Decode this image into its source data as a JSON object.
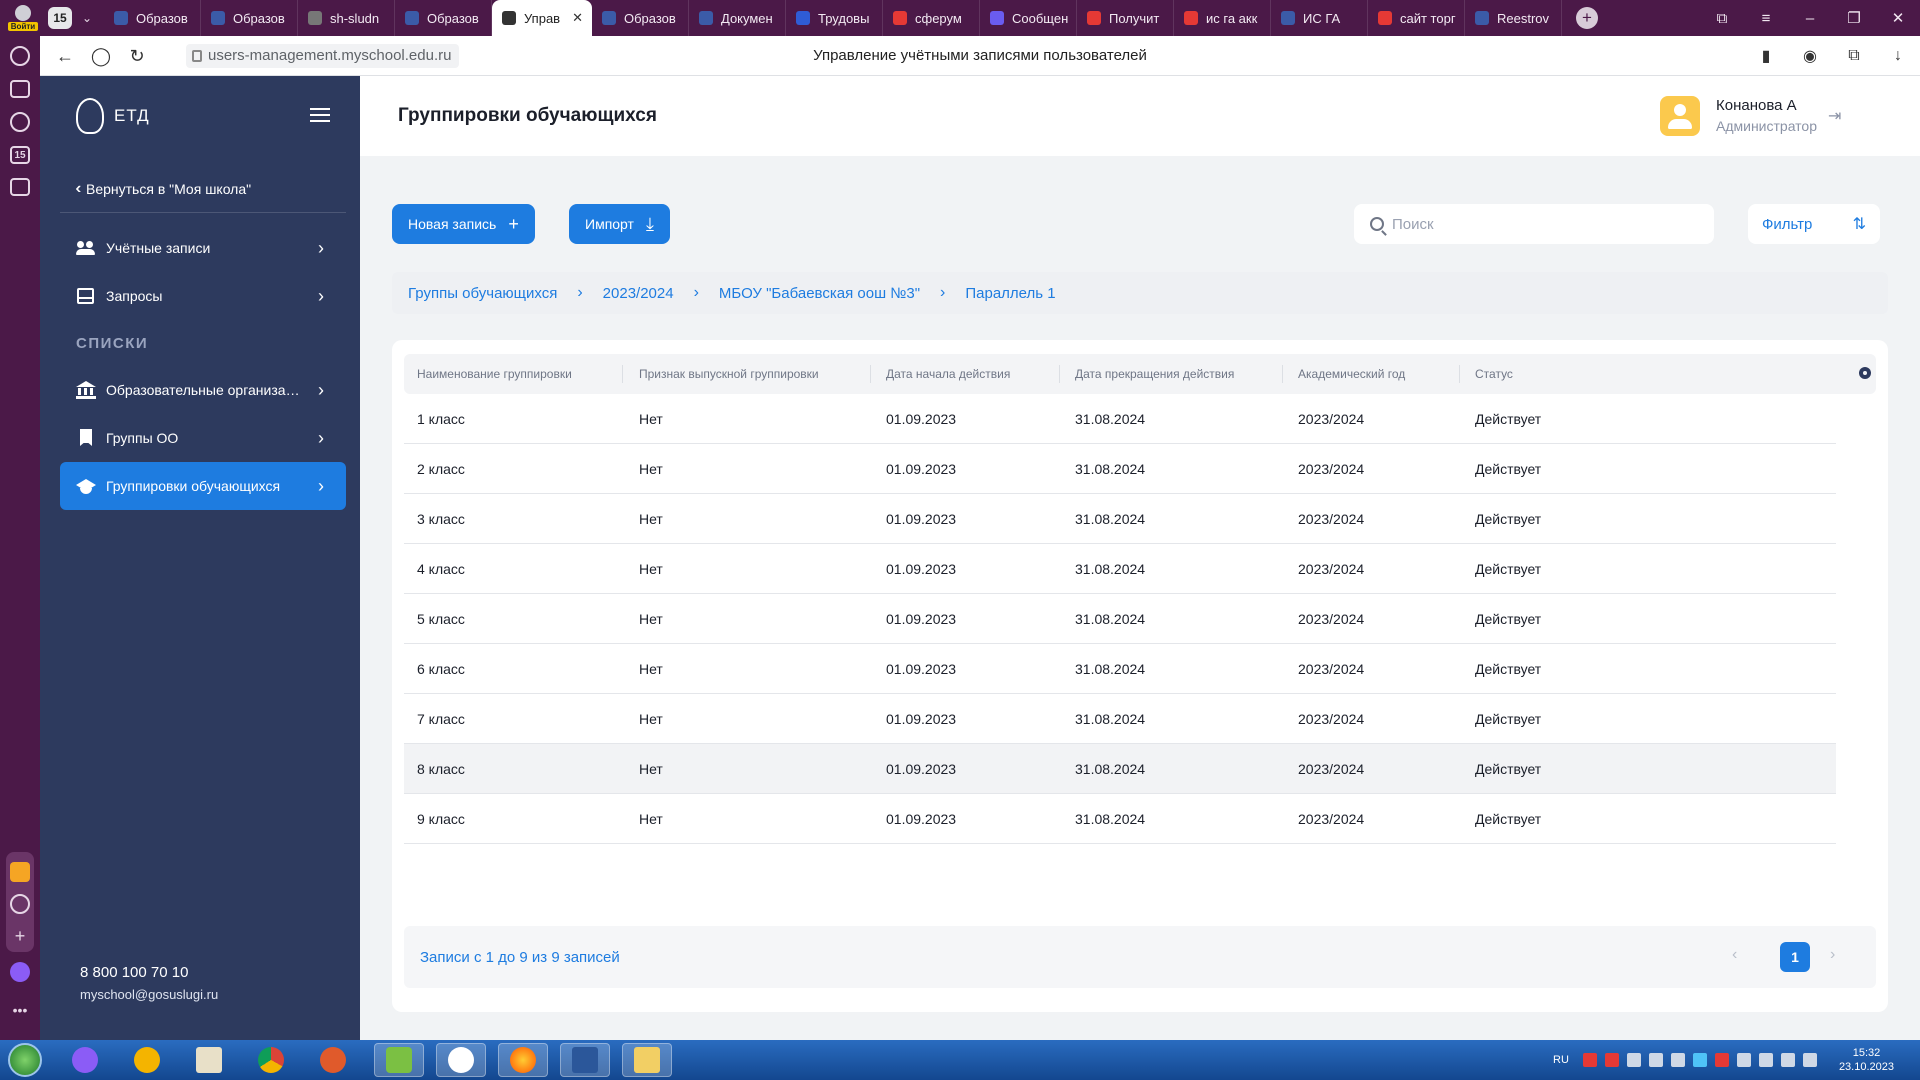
{
  "browser": {
    "profile_label": "Войти",
    "tab_count": "15",
    "tabs": [
      {
        "title": "Образов",
        "color": "#3b5ba8"
      },
      {
        "title": "Образов",
        "color": "#3b5ba8"
      },
      {
        "title": "sh-sludn",
        "color": "#777777"
      },
      {
        "title": "Образов",
        "color": "#3b5ba8"
      },
      {
        "title": "Управ",
        "color": "#333333",
        "active": true
      },
      {
        "title": "Образов",
        "color": "#3b5ba8"
      },
      {
        "title": "Докумен",
        "color": "#3b5ba8"
      },
      {
        "title": "Трудовы",
        "color": "#2f5cd6"
      },
      {
        "title": "сферум",
        "color": "#e53935"
      },
      {
        "title": "Сообщен",
        "color": "#6a5cf0"
      },
      {
        "title": "Получит",
        "color": "#e53935"
      },
      {
        "title": "ис га акк",
        "color": "#e53935"
      },
      {
        "title": "ИС ГА",
        "color": "#3b5ba8"
      },
      {
        "title": "сайт торг",
        "color": "#e53935"
      },
      {
        "title": "Reestrov",
        "color": "#3b5ba8"
      }
    ],
    "url": "users-management.myschool.edu.ru",
    "page_title": "Управление учётными записями пользователей"
  },
  "sidebar": {
    "logo_text": "ЕТД",
    "back_link": "Вернуться в \"Моя школа\"",
    "items": [
      {
        "label": "Учётные записи"
      },
      {
        "label": "Запросы"
      }
    ],
    "section_title": "СПИСКИ",
    "list_items": [
      {
        "label": "Образовательные организации"
      },
      {
        "label": "Группы ОО"
      },
      {
        "label": "Группировки обучающихся"
      }
    ],
    "phone": "8 800 100 70 10",
    "email": "myschool@gosuslugi.ru"
  },
  "header": {
    "title": "Группировки обучающихся",
    "user_name": "Конанова А",
    "user_role": "Администратор"
  },
  "toolbar": {
    "new_record": "Новая запись",
    "import": "Импорт",
    "search_placeholder": "Поиск",
    "filter": "Фильтр"
  },
  "breadcrumb": [
    "Группы обучающихся",
    "2023/2024",
    "МБОУ \"Бабаевская оош №3\"",
    "Параллель 1"
  ],
  "table": {
    "columns": [
      "Наименование группировки",
      "Признак выпускной группировки",
      "Дата начала действия",
      "Дата прекращения действия",
      "Академический год",
      "Статус"
    ],
    "rows": [
      [
        "1 класс",
        "Нет",
        "01.09.2023",
        "31.08.2024",
        "2023/2024",
        "Действует"
      ],
      [
        "2 класс",
        "Нет",
        "01.09.2023",
        "31.08.2024",
        "2023/2024",
        "Действует"
      ],
      [
        "3 класс",
        "Нет",
        "01.09.2023",
        "31.08.2024",
        "2023/2024",
        "Действует"
      ],
      [
        "4 класс",
        "Нет",
        "01.09.2023",
        "31.08.2024",
        "2023/2024",
        "Действует"
      ],
      [
        "5 класс",
        "Нет",
        "01.09.2023",
        "31.08.2024",
        "2023/2024",
        "Действует"
      ],
      [
        "6 класс",
        "Нет",
        "01.09.2023",
        "31.08.2024",
        "2023/2024",
        "Действует"
      ],
      [
        "7 класс",
        "Нет",
        "01.09.2023",
        "31.08.2024",
        "2023/2024",
        "Действует"
      ],
      [
        "8 класс",
        "Нет",
        "01.09.2023",
        "31.08.2024",
        "2023/2024",
        "Действует"
      ],
      [
        "9 класс",
        "Нет",
        "01.09.2023",
        "31.08.2024",
        "2023/2024",
        "Действует"
      ]
    ],
    "records_text": "Записи с 1 до 9 из 9 записей",
    "current_page": "1"
  },
  "taskbar": {
    "lang": "RU",
    "time": "15:32",
    "date": "23.10.2023"
  },
  "colors": {
    "accent": "#1e7ce0",
    "sidebar": "#2d3a5e",
    "browser_frame": "#4b1948"
  }
}
